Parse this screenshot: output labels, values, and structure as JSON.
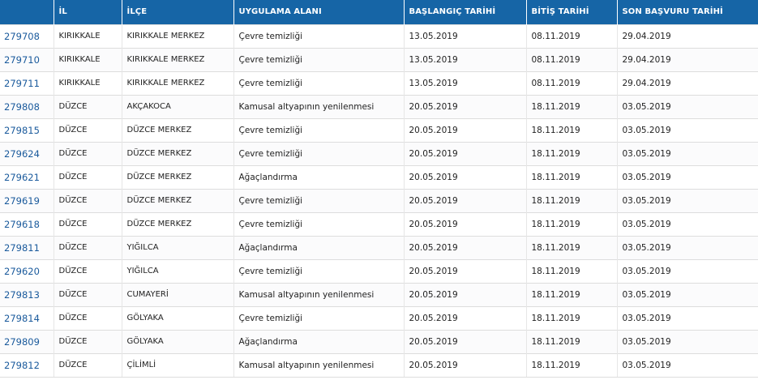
{
  "colors": {
    "header_bg": "#1665a6",
    "header_text": "#ffffff",
    "link": "#1a5a9c",
    "row_border": "#dddddd"
  },
  "table": {
    "columns": [
      "",
      "İL",
      "İLÇE",
      "UYGULAMA ALANI",
      "BAŞLANGIÇ TARİHİ",
      "BİTİŞ TARİHİ",
      "SON BAŞVURU TARİHİ"
    ],
    "rows": [
      [
        "279708",
        "KIRIKKALE",
        "KIRIKKALE MERKEZ",
        "Çevre temizliği",
        "13.05.2019",
        "08.11.2019",
        "29.04.2019"
      ],
      [
        "279710",
        "KIRIKKALE",
        "KIRIKKALE MERKEZ",
        "Çevre temizliği",
        "13.05.2019",
        "08.11.2019",
        "29.04.2019"
      ],
      [
        "279711",
        "KIRIKKALE",
        "KIRIKKALE MERKEZ",
        "Çevre temizliği",
        "13.05.2019",
        "08.11.2019",
        "29.04.2019"
      ],
      [
        "279808",
        "DÜZCE",
        "AKÇAKOCA",
        "Kamusal altyapının yenilenmesi",
        "20.05.2019",
        "18.11.2019",
        "03.05.2019"
      ],
      [
        "279815",
        "DÜZCE",
        "DÜZCE MERKEZ",
        "Çevre temizliği",
        "20.05.2019",
        "18.11.2019",
        "03.05.2019"
      ],
      [
        "279624",
        "DÜZCE",
        "DÜZCE MERKEZ",
        "Çevre temizliği",
        "20.05.2019",
        "18.11.2019",
        "03.05.2019"
      ],
      [
        "279621",
        "DÜZCE",
        "DÜZCE MERKEZ",
        "Ağaçlandırma",
        "20.05.2019",
        "18.11.2019",
        "03.05.2019"
      ],
      [
        "279619",
        "DÜZCE",
        "DÜZCE MERKEZ",
        "Çevre temizliği",
        "20.05.2019",
        "18.11.2019",
        "03.05.2019"
      ],
      [
        "279618",
        "DÜZCE",
        "DÜZCE MERKEZ",
        "Çevre temizliği",
        "20.05.2019",
        "18.11.2019",
        "03.05.2019"
      ],
      [
        "279811",
        "DÜZCE",
        "YIĞILCA",
        "Ağaçlandırma",
        "20.05.2019",
        "18.11.2019",
        "03.05.2019"
      ],
      [
        "279620",
        "DÜZCE",
        "YIĞILCA",
        "Çevre temizliği",
        "20.05.2019",
        "18.11.2019",
        "03.05.2019"
      ],
      [
        "279813",
        "DÜZCE",
        "CUMAYERİ",
        "Kamusal altyapının yenilenmesi",
        "20.05.2019",
        "18.11.2019",
        "03.05.2019"
      ],
      [
        "279814",
        "DÜZCE",
        "GÖLYAKA",
        "Çevre temizliği",
        "20.05.2019",
        "18.11.2019",
        "03.05.2019"
      ],
      [
        "279809",
        "DÜZCE",
        "GÖLYAKA",
        "Ağaçlandırma",
        "20.05.2019",
        "18.11.2019",
        "03.05.2019"
      ],
      [
        "279812",
        "DÜZCE",
        "ÇİLİMLİ",
        "Kamusal altyapının yenilenmesi",
        "20.05.2019",
        "18.11.2019",
        "03.05.2019"
      ]
    ]
  }
}
